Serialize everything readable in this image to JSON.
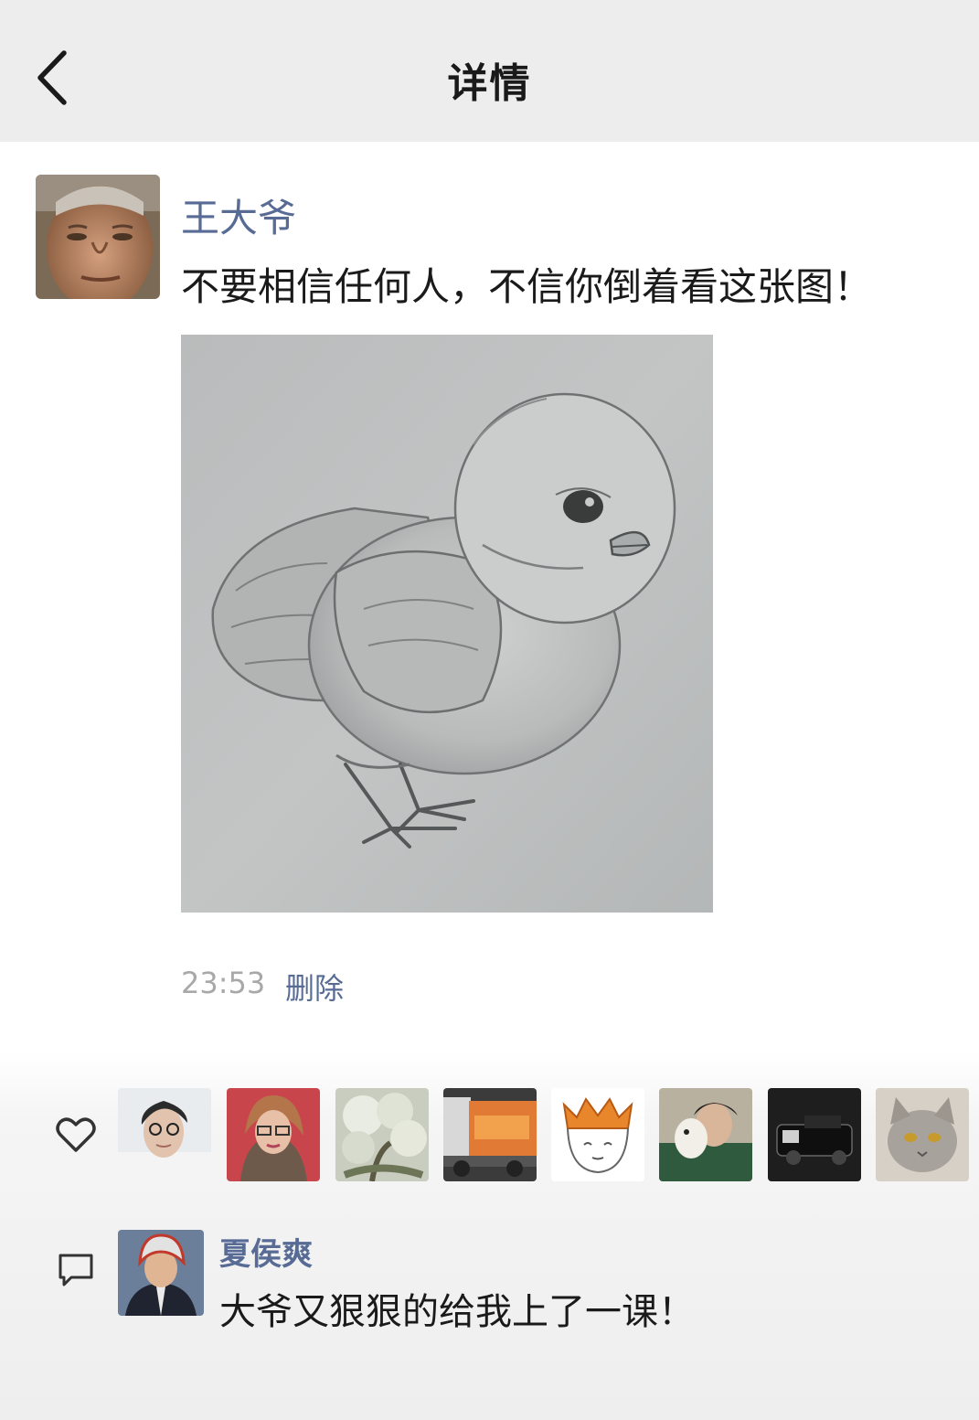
{
  "header": {
    "title": "详情",
    "back_icon": "chevron-left-icon"
  },
  "post": {
    "author": "王大爷",
    "text": "不要相信任何人，不信你倒着看这张图！",
    "time": "23:53",
    "delete_label": "删除"
  },
  "likes": {
    "icon": "heart-icon",
    "avatars": [
      "avatar-1",
      "avatar-2",
      "avatar-3",
      "avatar-4",
      "avatar-5",
      "avatar-6",
      "avatar-7",
      "avatar-8"
    ]
  },
  "comments": [
    {
      "author": "夏侯爽",
      "text": "大爷又狠狠的给我上了一课！"
    }
  ],
  "colors": {
    "link": "#576b95",
    "header_bg": "#ededed",
    "timestamp": "#a8a8a8"
  }
}
